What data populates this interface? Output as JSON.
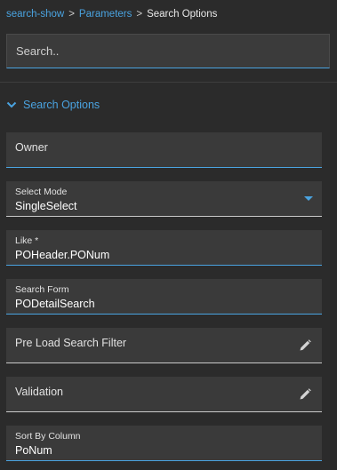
{
  "breadcrumb": {
    "items": [
      "search-show",
      "Parameters",
      "Search Options"
    ],
    "separator": ">"
  },
  "search": {
    "placeholder": "Search.."
  },
  "section": {
    "title": "Search Options"
  },
  "fields": {
    "owner": {
      "label": "Owner"
    },
    "select_mode": {
      "label": "Select Mode",
      "value": "SingleSelect"
    },
    "like": {
      "label": "Like *",
      "value": "POHeader.PONum"
    },
    "search_form": {
      "label": "Search Form",
      "value": "PODetailSearch"
    },
    "pre_load": {
      "label": "Pre Load Search Filter"
    },
    "validation": {
      "label": "Validation"
    },
    "sort_by": {
      "label": "Sort By Column",
      "value": "PoNum"
    }
  },
  "colors": {
    "accent": "#4aa3e0",
    "background": "#2b2b2b",
    "field_background": "#3a3a3a",
    "text": "#e2e2e2"
  },
  "icons": {
    "section_toggle": "chevron-down-icon",
    "select_dropdown": "caret-down-icon",
    "edit": "pencil-icon"
  }
}
